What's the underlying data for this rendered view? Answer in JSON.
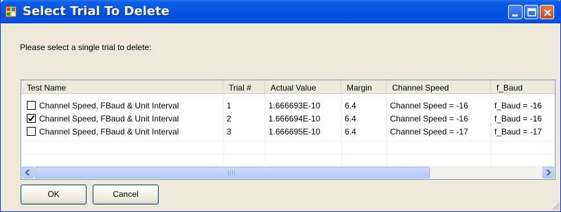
{
  "window": {
    "title": "Select Trial To Delete",
    "accent": "#0a5fe8",
    "close_color": "#c9461d"
  },
  "prompt": "Please select a single trial to delete:",
  "table": {
    "columns": [
      "Test Name",
      "Trial #",
      "Actual Value",
      "Margin",
      "Channel Speed",
      "f_Baud"
    ],
    "rows": [
      {
        "checked": false,
        "cells": [
          "Channel Speed, FBaud & Unit Interval",
          "1",
          "1.666693E-10",
          "6.4",
          "Channel Speed = -16",
          "f_Baud = -16"
        ]
      },
      {
        "checked": true,
        "cells": [
          "Channel Speed, FBaud & Unit Interval",
          "2",
          "1.666694E-10",
          "6.4",
          "Channel Speed = -16",
          "f_Baud = -16"
        ]
      },
      {
        "checked": false,
        "cells": [
          "Channel Speed, FBaud & Unit Interval",
          "3",
          "1.666695E-10",
          "6.4",
          "Channel Speed = -17",
          "f_Baud = -17"
        ]
      }
    ]
  },
  "buttons": {
    "ok": "OK",
    "cancel": "Cancel"
  },
  "icons": {
    "app": "app-window-icon",
    "minimize": "minimize-icon",
    "maximize": "maximize-icon",
    "close": "close-icon",
    "scroll_left": "arrow-left-icon",
    "scroll_right": "arrow-right-icon",
    "resize": "resize-grip-icon"
  }
}
